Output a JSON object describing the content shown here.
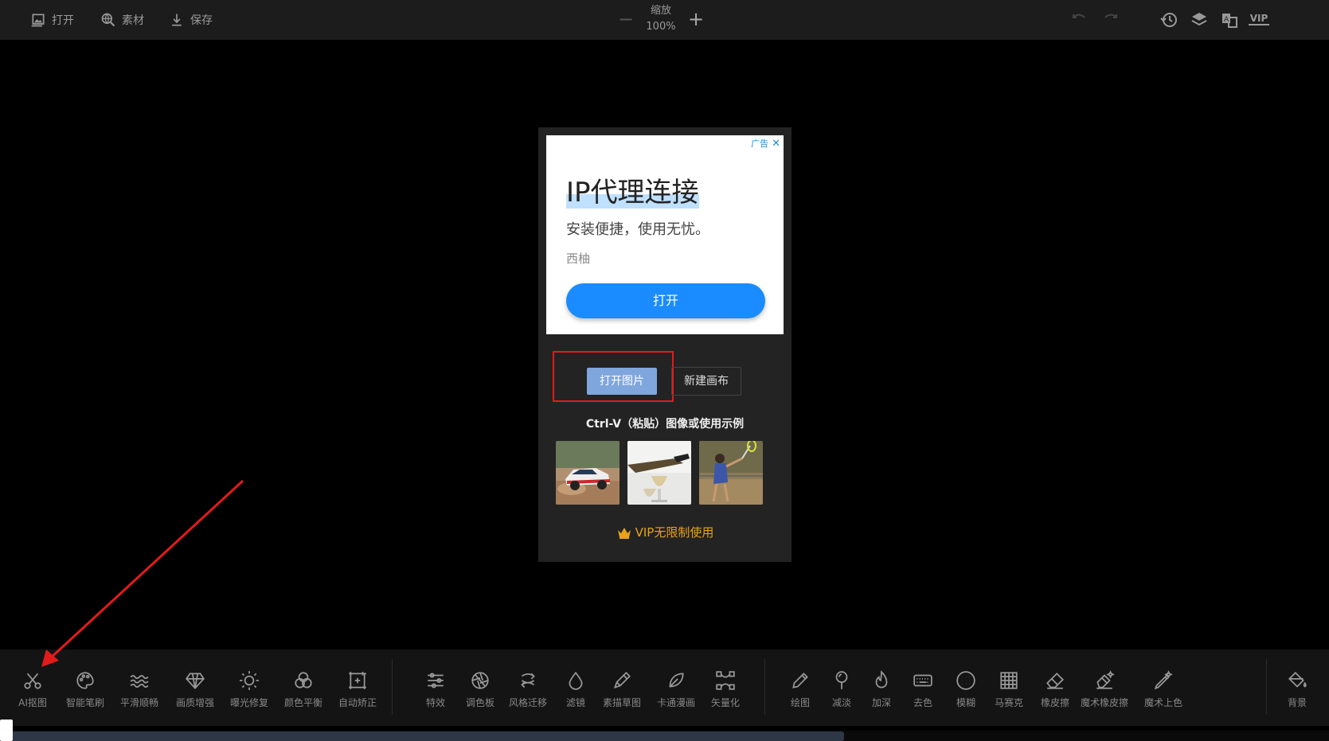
{
  "toolbar": {
    "open": "打开",
    "material": "素材",
    "save": "保存",
    "zoom_label": "缩放",
    "zoom_value": "100%",
    "vip_badge": "VIP"
  },
  "ad": {
    "tag": "广告",
    "title": "IP代理连接",
    "subtitle": "安装便捷，使用无忧。",
    "source": "西柚",
    "button": "打开"
  },
  "panel": {
    "open_image": "打开图片",
    "new_canvas": "新建画布",
    "hint": "Ctrl-V（粘贴）图像或使用示例",
    "vip_text": "VIP无限制使用",
    "thumbnails": [
      "rally-car",
      "wine-glass",
      "tennis-player"
    ]
  },
  "tools": [
    {
      "label": "AI抠图",
      "icon": "scissors-icon"
    },
    {
      "label": "智能笔刷",
      "icon": "palette-icon"
    },
    {
      "label": "平滑顺畅",
      "icon": "waves-icon"
    },
    {
      "label": "画质增强",
      "icon": "diamond-icon"
    },
    {
      "label": "曝光修复",
      "icon": "brightness-icon"
    },
    {
      "label": "颜色平衡",
      "icon": "color-circles-icon"
    },
    {
      "label": "自动矫正",
      "icon": "crop-frame-icon"
    },
    {
      "label": "特效",
      "icon": "sliders-icon"
    },
    {
      "label": "调色板",
      "icon": "aperture-icon"
    },
    {
      "label": "风格迁移",
      "icon": "style-transfer-icon"
    },
    {
      "label": "滤镜",
      "icon": "drop-icon"
    },
    {
      "label": "素描草图",
      "icon": "pencil-sketch-icon"
    },
    {
      "label": "卡通漫画",
      "icon": "leaf-icon"
    },
    {
      "label": "矢量化",
      "icon": "vector-nodes-icon"
    },
    {
      "label": "绘图",
      "icon": "pen-icon"
    },
    {
      "label": "减淡",
      "icon": "dodge-icon"
    },
    {
      "label": "加深",
      "icon": "flame-icon"
    },
    {
      "label": "去色",
      "icon": "keyboard-icon"
    },
    {
      "label": "模糊",
      "icon": "blur-grid-icon"
    },
    {
      "label": "马赛克",
      "icon": "mosaic-icon"
    },
    {
      "label": "橡皮擦",
      "icon": "eraser-icon"
    },
    {
      "label": "魔术橡皮擦",
      "icon": "magic-eraser-icon"
    },
    {
      "label": "魔术上色",
      "icon": "magic-brush-icon"
    },
    {
      "label": "背景",
      "icon": "paint-bucket-icon"
    }
  ]
}
